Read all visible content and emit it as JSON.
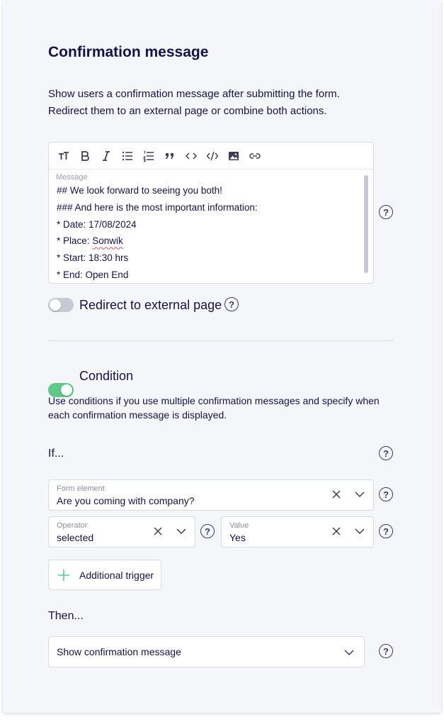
{
  "confirmation": {
    "title": "Confirmation message",
    "description_line1": "Show users a confirmation message after submitting the form.",
    "description_line2": "Redirect them to an external page or combine both actions.",
    "editor": {
      "label": "Message",
      "lines": [
        "## We look forward to seeing you both!",
        "### And here is the most important information:",
        "* Date: 17/08/2024",
        "* Place: ",
        "* Start: 18:30 hrs",
        "* End: Open End"
      ],
      "misspelled_word": "Sonwik",
      "toolbar": [
        "text-size-icon",
        "bold-icon",
        "italic-icon",
        "bullet-list-icon",
        "numbered-list-icon",
        "quote-icon",
        "code-icon",
        "code-block-icon",
        "image-icon",
        "link-icon"
      ]
    },
    "help_symbol": "?"
  },
  "redirect": {
    "label": "Redirect to external page",
    "enabled": false
  },
  "condition": {
    "label": "Condition",
    "enabled": true,
    "description_line1": "Use conditions if you use multiple confirmation messages and specify when",
    "description_line2": "each confirmation message is displayed.",
    "if_label": "If...",
    "form_element": {
      "label": "Form element",
      "value": "Are you coming with company?"
    },
    "operator": {
      "label": "Operator",
      "value": "selected"
    },
    "value": {
      "label": "Value",
      "value": "Yes"
    },
    "add_trigger_label": "Additional trigger",
    "then_label": "Then...",
    "action": {
      "value": "Show confirmation message"
    }
  },
  "colors": {
    "accent_green": "#5ccb8a",
    "text_navy": "#14124a",
    "toggle_off": "#c8c8d4",
    "background": "#f5f6fa"
  }
}
